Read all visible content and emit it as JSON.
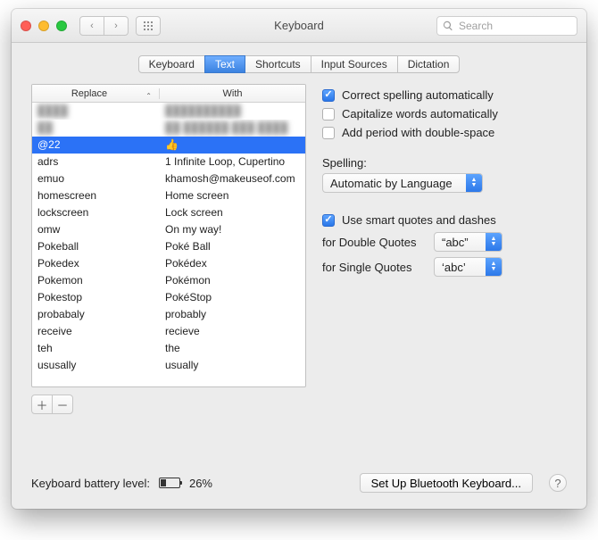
{
  "window": {
    "title": "Keyboard"
  },
  "toolbar": {
    "search_placeholder": "Search"
  },
  "tabs": [
    {
      "label": "Keyboard"
    },
    {
      "label": "Text"
    },
    {
      "label": "Shortcuts"
    },
    {
      "label": "Input Sources"
    },
    {
      "label": "Dictation"
    }
  ],
  "active_tab": 1,
  "table": {
    "col_replace": "Replace",
    "col_with": "With",
    "rows": [
      {
        "replace": "████",
        "with": "██████████",
        "blurred": true
      },
      {
        "replace": "██",
        "with": "██ ██████ ███ ████",
        "blurred": true
      },
      {
        "replace": "@22",
        "with": "👍",
        "selected": true
      },
      {
        "replace": "adrs",
        "with": "1 Infinite Loop, Cupertino"
      },
      {
        "replace": "emuo",
        "with": "khamosh@makeuseof.com"
      },
      {
        "replace": "homescreen",
        "with": "Home screen"
      },
      {
        "replace": "lockscreen",
        "with": "Lock screen"
      },
      {
        "replace": "omw",
        "with": "On my way!"
      },
      {
        "replace": "Pokeball",
        "with": "Poké Ball"
      },
      {
        "replace": "Pokedex",
        "with": "Pokédex"
      },
      {
        "replace": "Pokemon",
        "with": "Pokémon"
      },
      {
        "replace": "Pokestop",
        "with": "PokéStop"
      },
      {
        "replace": "probabaly",
        "with": "probably"
      },
      {
        "replace": "receive",
        "with": "recieve"
      },
      {
        "replace": "teh",
        "with": "the"
      },
      {
        "replace": "ususally",
        "with": "usually"
      }
    ]
  },
  "options": {
    "correct_spelling": {
      "label": "Correct spelling automatically",
      "checked": true
    },
    "capitalize": {
      "label": "Capitalize words automatically",
      "checked": false
    },
    "add_period": {
      "label": "Add period with double-space",
      "checked": false
    },
    "spelling_label": "Spelling:",
    "spelling_value": "Automatic by Language",
    "smart_quotes": {
      "label": "Use smart quotes and dashes",
      "checked": true
    },
    "double_label": "for Double Quotes",
    "double_value": "“abc”",
    "single_label": "for Single Quotes",
    "single_value": "‘abc’"
  },
  "footer": {
    "battery_label": "Keyboard battery level:",
    "battery_pct": "26%",
    "bluetooth_btn": "Set Up Bluetooth Keyboard..."
  }
}
